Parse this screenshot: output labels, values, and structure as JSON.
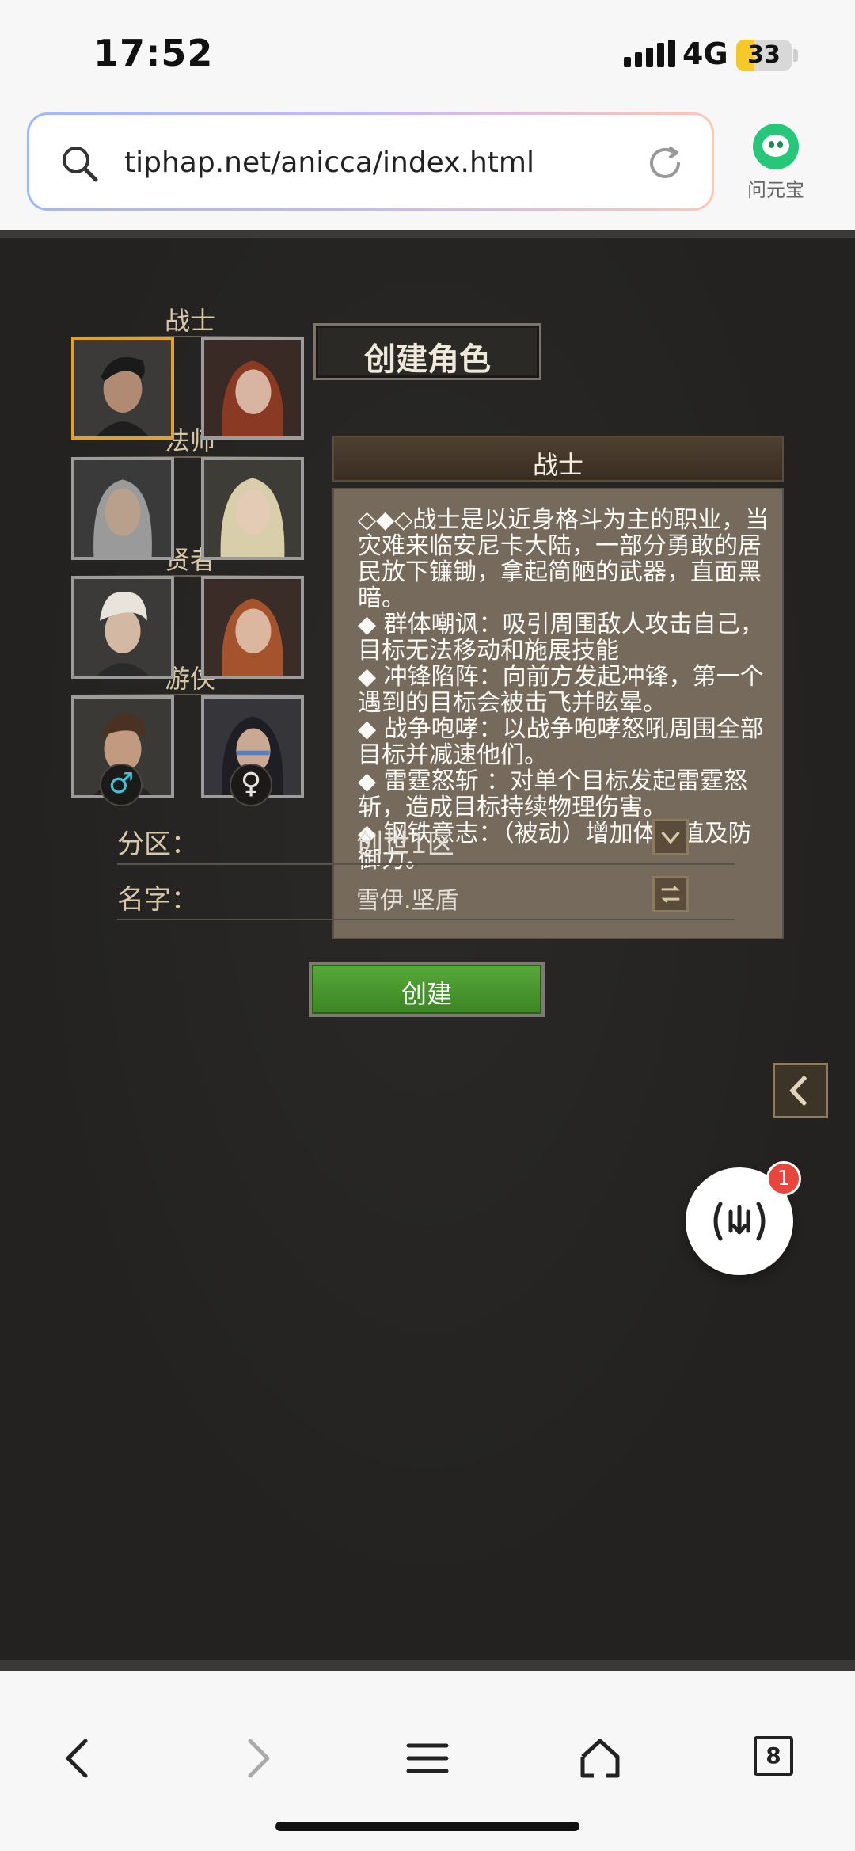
{
  "status_bar": {
    "time": "17:52",
    "network": "4G",
    "battery_level": "33",
    "battery_percent": 0.33
  },
  "browser": {
    "url": "tiphap.net/anicca/index.html",
    "assistant_label": "问元宝",
    "tab_count": "8"
  },
  "game": {
    "title": "创建角色",
    "classes": [
      {
        "label": "战士"
      },
      {
        "label": "法师"
      },
      {
        "label": "贤者"
      },
      {
        "label": "游侠"
      }
    ],
    "gender": {
      "male": "♂",
      "female": "♀"
    },
    "description": {
      "header": "战士",
      "text": "◇◆◇战士是以近身格斗为主的职业，当灾难来临安尼卡大陆，一部分勇敢的居民放下镰锄，拿起简陋的武器，直面黑暗。\n◆ 群体嘲讽：吸引周围敌人攻击自己，目标无法移动和施展技能\n◆ 冲锋陷阵：向前方发起冲锋，第一个遇到的目标会被击飞并眩晕。\n◆ 战争咆哮：以战争咆哮怒吼周围全部目标并减速他们。\n◆ 雷霆怒斩 ：对单个目标发起雷霆怒斩，造成目标持续物理伤害。\n◆ 钢铁意志：（被动）增加体力值及防御力。"
    },
    "form": {
      "server_label": "分区：",
      "server_value": "创世1区",
      "name_label": "名字：",
      "name_value": "雪伊.坚盾"
    },
    "create_label": "创建",
    "notification_count": "1"
  },
  "colors": {
    "accent_selected": "#e2a02d",
    "create_green": "#4a9a2e",
    "badge_red": "#e8453c"
  }
}
